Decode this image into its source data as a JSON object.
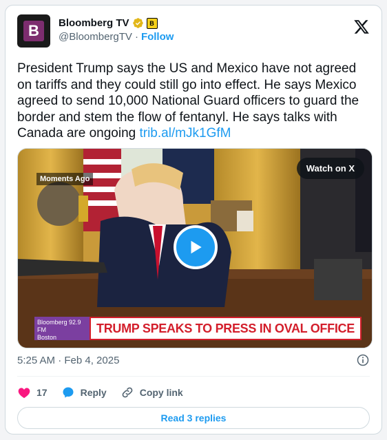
{
  "account": {
    "name": "Bloomberg TV",
    "handle": "@BloombergTV",
    "separator": "·",
    "follow_label": "Follow",
    "avatar_letter": "B",
    "affiliate_badge": "B"
  },
  "tweet": {
    "text": "President Trump says the US and Mexico have not agreed on tariffs and they could still go into effect. He says Mexico agreed to send 10,000 National Guard officers to guard the border and stem the flow of fentanyl. He says talks with Canada are ongoing ",
    "link": "trib.al/mJk1GfM",
    "timestamp": "5:25 AM · Feb 4, 2025"
  },
  "media": {
    "watch_label": "Watch on X",
    "live_label": "Moments Ago",
    "channel_label_line1": "Bloomberg 92.9 FM",
    "channel_label_line2": "Boston",
    "headline": "TRUMP SPEAKS TO PRESS IN OVAL OFFICE"
  },
  "actions": {
    "like_count": "17",
    "reply_label": "Reply",
    "copy_label": "Copy link"
  },
  "replies_button": "Read 3 replies",
  "colors": {
    "accent": "#1d9bf0",
    "like": "#f91880",
    "banner_red": "#d31e2b"
  }
}
